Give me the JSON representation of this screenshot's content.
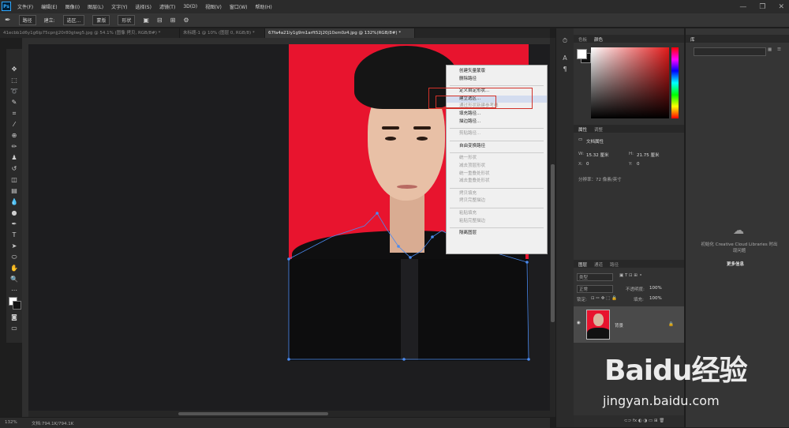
{
  "menubar": {
    "logo": "Ps",
    "menus": [
      "文件(F)",
      "编辑(E)",
      "图像(I)",
      "图层(L)",
      "文字(Y)",
      "选择(S)",
      "滤镜(T)",
      "3D(D)",
      "视图(V)",
      "窗口(W)",
      "帮助(H)"
    ],
    "window_controls": [
      "—",
      "❐",
      "✕"
    ]
  },
  "options_bar": {
    "tool_mode": "路径",
    "make_label": "建立:",
    "selection_button": "选区...",
    "mask_button": "蒙版",
    "shape_button": "形状"
  },
  "tabs": [
    {
      "label": "41ecbb1d6y1g6lp75cpnjj20r80gtwg5.jpg @ 54.1% (图像 拷贝, RGB/8#) *",
      "active": false
    },
    {
      "label": "未标题-1 @ 10% (图层 0, RGB/8) *",
      "active": false
    },
    {
      "label": "67fa4a21ly1g9m1arft52j20j10xm0z4.jpg @ 132%(RGB/8#) *",
      "active": true
    }
  ],
  "context_menu": {
    "items": [
      {
        "label": "创建矢量蒙版",
        "state": "normal"
      },
      {
        "label": "删除路径",
        "state": "normal"
      },
      {
        "sep": true
      },
      {
        "label": "定义自定形状...",
        "state": "normal"
      },
      {
        "label": "建立选区...",
        "state": "highlighted"
      },
      {
        "label": "通过形状新建参考线",
        "state": "disabled"
      },
      {
        "label": "填充路径...",
        "state": "normal"
      },
      {
        "label": "描边路径...",
        "state": "normal"
      },
      {
        "sep": true
      },
      {
        "label": "剪贴路径...",
        "state": "disabled"
      },
      {
        "sep": true
      },
      {
        "label": "自由变换路径",
        "state": "normal"
      },
      {
        "sep": true
      },
      {
        "label": "统一形状",
        "state": "disabled"
      },
      {
        "label": "减去顶层形状",
        "state": "disabled"
      },
      {
        "label": "统一重叠处形状",
        "state": "disabled"
      },
      {
        "label": "减去重叠处形状",
        "state": "disabled"
      },
      {
        "sep": true
      },
      {
        "label": "拷贝填充",
        "state": "disabled"
      },
      {
        "label": "拷贝完整描边",
        "state": "disabled"
      },
      {
        "sep": true
      },
      {
        "label": "粘贴填充",
        "state": "disabled"
      },
      {
        "label": "粘贴完整描边",
        "state": "disabled"
      },
      {
        "sep": true
      },
      {
        "label": "隔离图层",
        "state": "normal"
      }
    ]
  },
  "status_bar": {
    "zoom": "132%",
    "doc_info": "文档:794.1K/794.1K"
  },
  "color_panel": {
    "tabs": [
      "色板",
      "颜色"
    ],
    "foreground": "#ffffff",
    "background": "#111111",
    "picker_hue": "#e21a1a"
  },
  "properties_panel": {
    "tabs": [
      "属性",
      "调整"
    ],
    "title": "文档属性",
    "w_label": "W:",
    "w_value": "15.32 厘米",
    "h_label": "H:",
    "h_value": "21.75 厘米",
    "x_label": "X:",
    "x_value": "0",
    "y_label": "Y:",
    "y_value": "0",
    "resolution": "分辨率：72 像素/英寸"
  },
  "layers_panel": {
    "tabs": [
      "图层",
      "通道",
      "路径"
    ],
    "filter_kind": "类型",
    "blend_mode": "正常",
    "opacity_label": "不透明度:",
    "opacity_value": "100%",
    "lock_label": "锁定:",
    "fill_label": "填充:",
    "fill_value": "100%",
    "layer_name": "背景"
  },
  "libraries_panel": {
    "tab": "库",
    "message": "初始化 Creative Cloud Libraries 时出现问题",
    "more_info": "更多信息"
  },
  "watermark": {
    "logo": "Baidu经验",
    "url": "jingyan.baidu.com"
  },
  "colors": {
    "photo_bg": "#e8142e",
    "highlight_box": "#d2322a",
    "menu_highlight": "#d3dcef",
    "path_anchor": "#4b8bf0"
  }
}
